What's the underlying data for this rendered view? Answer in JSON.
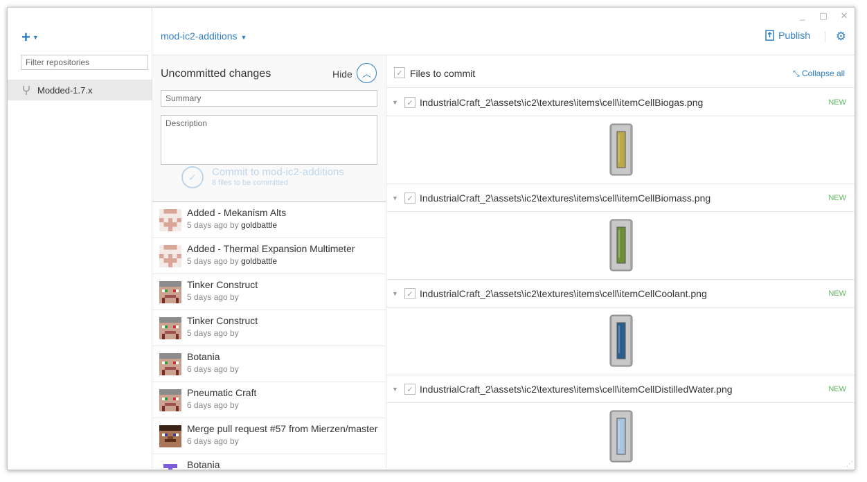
{
  "window": {
    "controls": {
      "minimize": "_",
      "maximize": "▢",
      "close": "✕"
    }
  },
  "sidebar": {
    "add_icon": "plus-icon",
    "filter_placeholder": "Filter repositories",
    "repos": [
      {
        "label": "Modded-1.7.x",
        "icon": "repo-fork-icon"
      }
    ]
  },
  "topbar": {
    "branch": "mod-ic2-additions",
    "publish_label": "Publish",
    "accent_color": "#2f7dc0"
  },
  "changes": {
    "title": "Uncommitted changes",
    "hide_label": "Hide",
    "summary_placeholder": "Summary",
    "description_placeholder": "Description",
    "commit_label": "Commit to mod-ic2-additions",
    "commit_sub": "8 files to be committed"
  },
  "history": [
    {
      "title": "Added - Mekanism Alts",
      "time": "5 days ago by",
      "author": "goldbattle",
      "avatar": "identicon"
    },
    {
      "title": "Added - Thermal Expansion Multimeter",
      "time": "5 days ago by",
      "author": "goldbattle",
      "avatar": "identicon"
    },
    {
      "title": "Tinker Construct",
      "time": "5 days ago by",
      "author": "",
      "avatar": "pixel-face"
    },
    {
      "title": "Tinker Construct",
      "time": "5 days ago by",
      "author": "",
      "avatar": "pixel-face"
    },
    {
      "title": "Botania",
      "time": "6 days ago by",
      "author": "",
      "avatar": "pixel-face"
    },
    {
      "title": "Pneumatic Craft",
      "time": "6 days ago by",
      "author": "",
      "avatar": "pixel-face"
    },
    {
      "title": "Merge pull request #57 from Mierzen/master",
      "time": "6 days ago by",
      "author": "",
      "avatar": "steve-face"
    },
    {
      "title": "Botania",
      "time": "",
      "author": "",
      "avatar": "purple-t"
    }
  ],
  "files": {
    "header": "Files to commit",
    "collapse_label": "Collapse all",
    "new_color": "#5cb85c",
    "items": [
      {
        "path": "IndustrialCraft_2\\assets\\ic2\\textures\\items\\cell\\itemCellBiogas.png",
        "status": "NEW",
        "cell_color": "#b8aa4a"
      },
      {
        "path": "IndustrialCraft_2\\assets\\ic2\\textures\\items\\cell\\itemCellBiomass.png",
        "status": "NEW",
        "cell_color": "#6f8f3a"
      },
      {
        "path": "IndustrialCraft_2\\assets\\ic2\\textures\\items\\cell\\itemCellCoolant.png",
        "status": "NEW",
        "cell_color": "#2d5f8e"
      },
      {
        "path": "IndustrialCraft_2\\assets\\ic2\\textures\\items\\cell\\itemCellDistilledWater.png",
        "status": "NEW",
        "cell_color": "#a9c6de"
      }
    ]
  }
}
